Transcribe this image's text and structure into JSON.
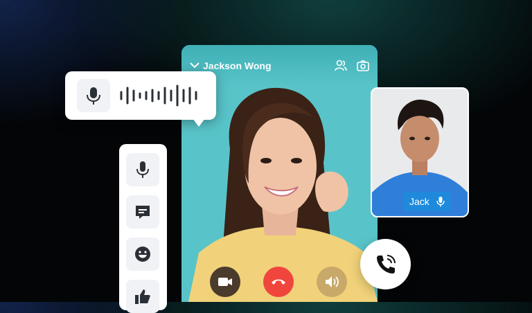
{
  "call": {
    "caller_name": "Jackson Wong",
    "controls": [
      {
        "icon": "video-camera-icon",
        "color": "#4b3b2c"
      },
      {
        "icon": "hang-up-icon",
        "color": "#f0453d"
      },
      {
        "icon": "speaker-icon",
        "color": "#c8a96a"
      }
    ]
  },
  "voice_message": {
    "icon": "microphone-icon"
  },
  "toolbar": {
    "items": [
      {
        "icon": "microphone-icon"
      },
      {
        "icon": "chat-message-icon"
      },
      {
        "icon": "emoji-smile-icon"
      },
      {
        "icon": "thumbs-up-icon"
      }
    ]
  },
  "participant": {
    "name": "Jack",
    "icon": "microphone-icon"
  },
  "accent_colors": {
    "hangup": "#f0453d",
    "panel": "#58c4c9",
    "label": "#1e8cdc"
  }
}
